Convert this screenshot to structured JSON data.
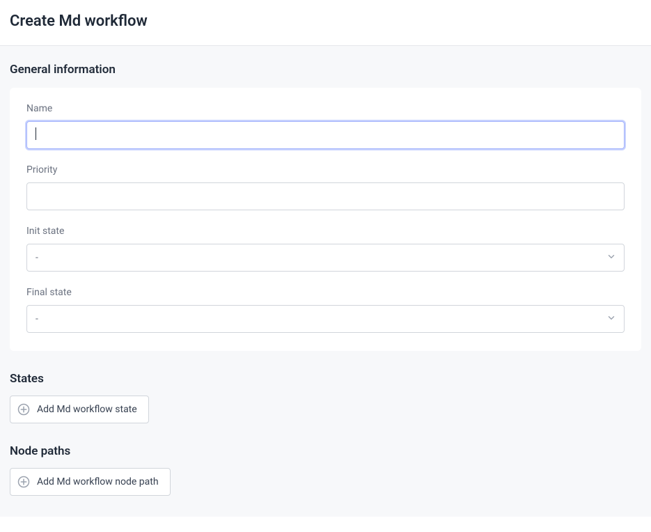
{
  "page": {
    "title": "Create Md workflow"
  },
  "general": {
    "heading": "General information",
    "fields": {
      "name": {
        "label": "Name",
        "value": ""
      },
      "priority": {
        "label": "Priority",
        "value": ""
      },
      "init_state": {
        "label": "Init state",
        "selected": "-"
      },
      "final_state": {
        "label": "Final state",
        "selected": "-"
      }
    }
  },
  "states": {
    "heading": "States",
    "add_button": "Add Md workflow state"
  },
  "node_paths": {
    "heading": "Node paths",
    "add_button": "Add Md workflow node path"
  }
}
